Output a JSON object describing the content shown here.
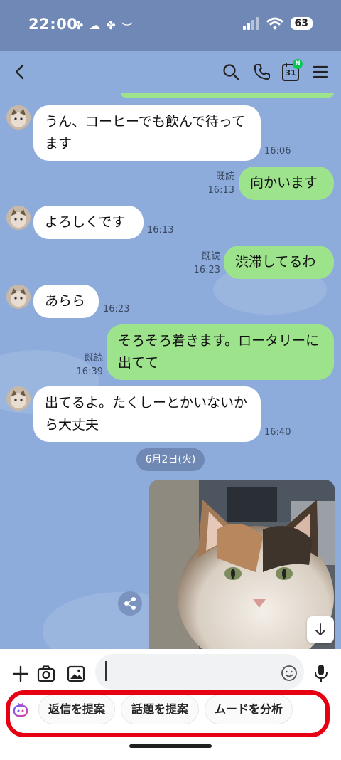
{
  "status_bar": {
    "time": "22:00",
    "battery": "63"
  },
  "header": {
    "back_icon": "chevron-left-icon",
    "search_icon": "search-icon",
    "call_icon": "phone-icon",
    "calendar_icon": "calendar-icon",
    "calendar_day": "31",
    "calendar_badge": "N",
    "menu_icon": "menu-icon"
  },
  "messages": [
    {
      "dir": "in",
      "text": "うん、コーヒーでも飲んで待ってます",
      "time": "16:06"
    },
    {
      "dir": "out",
      "text": "向かいます",
      "read": "既読",
      "time": "16:13"
    },
    {
      "dir": "in",
      "text": "よろしくです",
      "time": "16:13"
    },
    {
      "dir": "out",
      "text": "渋滞してるわ",
      "read": "既読",
      "time": "16:23"
    },
    {
      "dir": "in",
      "text": "あらら",
      "time": "16:23"
    },
    {
      "dir": "out",
      "text": "そろそろ着きます。ロータリーに出てて",
      "read": "既読",
      "time": "16:39"
    },
    {
      "dir": "in",
      "text": "出てるよ。たくしーとかいないから大丈夫",
      "time": "16:40"
    }
  ],
  "date_separator": "6月2日(火)",
  "photo_message": {
    "icon": "cat-photo"
  },
  "input_bar": {
    "placeholder": ""
  },
  "ai_suggestions": {
    "icon": "ai-assistant-icon",
    "chips": [
      "返信を提案",
      "話題を提案",
      "ムードを分析"
    ]
  },
  "colors": {
    "chat_bg": "#8dacdb",
    "bubble_out": "#9ce38c",
    "bubble_in": "#ffffff",
    "highlight": "#e60012",
    "badge": "#06c755"
  }
}
